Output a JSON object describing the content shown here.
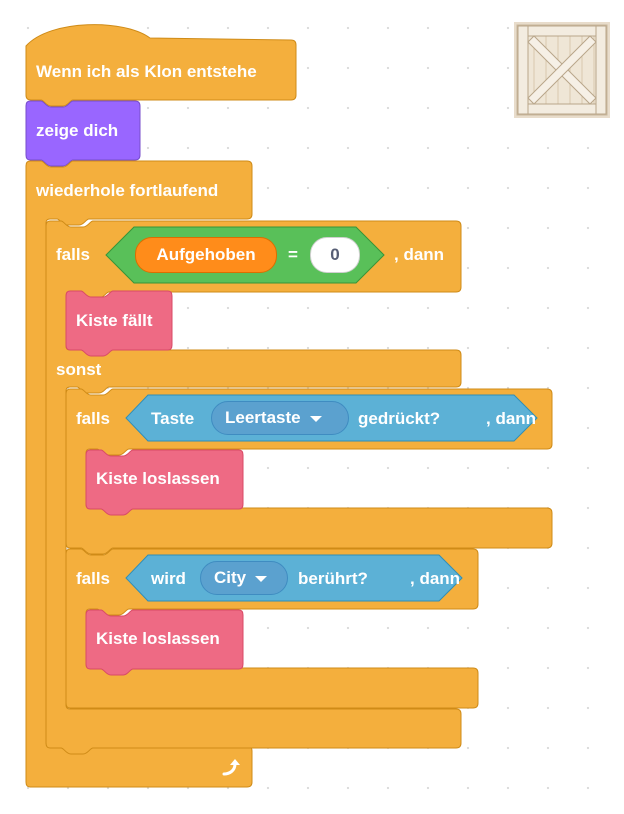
{
  "hat": {
    "label": "Wenn ich als Klon entstehe"
  },
  "show": {
    "label": "zeige dich"
  },
  "forever": {
    "label": "wiederhole fortlaufend"
  },
  "if1": {
    "falls": "falls",
    "dann": ", dann",
    "variable": "Aufgehoben",
    "operator": "=",
    "value": "0"
  },
  "call_fall": {
    "label": "Kiste fällt"
  },
  "else": {
    "label": "sonst"
  },
  "if2": {
    "falls": "falls",
    "dann": ", dann",
    "sensing_prefix": "Taste",
    "key": "Leertaste",
    "sensing_suffix": "gedrückt?"
  },
  "call_release_1": {
    "label": "Kiste loslassen"
  },
  "if3": {
    "falls": "falls",
    "dann": ", dann",
    "sensing_prefix": "wird",
    "sprite": "City",
    "sensing_suffix": "berührt?"
  },
  "call_release_2": {
    "label": "Kiste loslassen"
  },
  "sprite_thumbnail": {
    "icon": "wooden-crate-icon"
  },
  "colors": {
    "control": "#f4af3d",
    "control_border": "#cf8b17",
    "looks": "#9966ff",
    "looks_border": "#774dcb",
    "custom": "#ee6a84",
    "custom_border": "#d84a66",
    "operator": "#59c059",
    "operator_border": "#389438",
    "variable": "#ff8c1a",
    "variable_border": "#db6e00",
    "sensing": "#5cb1d6",
    "sensing_border": "#2e8eb8"
  }
}
